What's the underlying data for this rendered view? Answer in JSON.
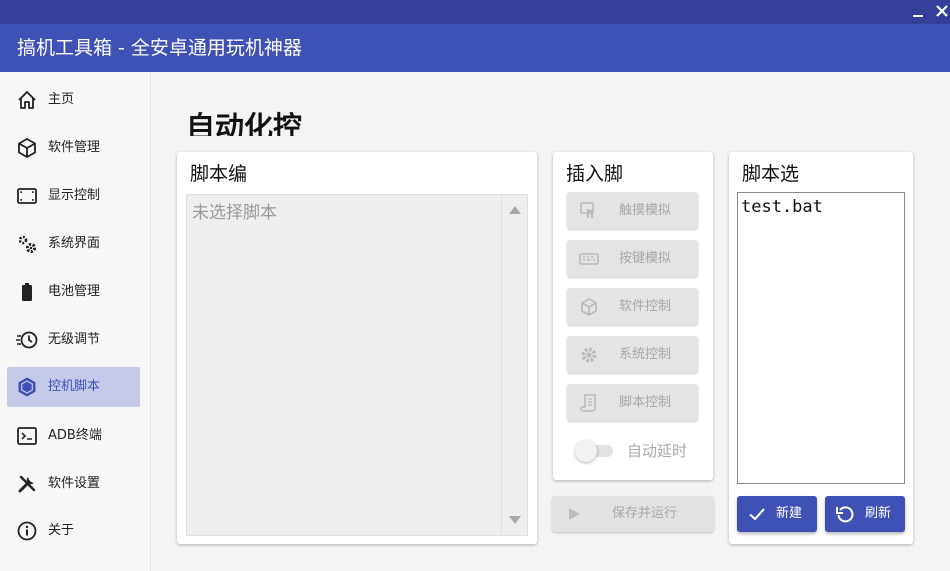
{
  "window": {
    "title": "搞机工具箱 - 全安卓通用玩机神器",
    "accent_color": "#3f51b5",
    "titlebar_strip_color": "#32409a",
    "controls": [
      "minimize-icon",
      "close-icon"
    ]
  },
  "sidebar": {
    "active_index": 6,
    "items": [
      {
        "label": "主页",
        "icon": "home-icon"
      },
      {
        "label": "软件管理",
        "icon": "package-icon"
      },
      {
        "label": "显示控制",
        "icon": "screen-icon"
      },
      {
        "label": "系统界面",
        "icon": "gears-icon"
      },
      {
        "label": "电池管理",
        "icon": "battery-icon"
      },
      {
        "label": "无级调节",
        "icon": "clock-speed-icon"
      },
      {
        "label": "控机脚本",
        "icon": "hexagon-icon"
      },
      {
        "label": "ADB终端",
        "icon": "terminal-icon"
      },
      {
        "label": "软件设置",
        "icon": "tools-icon"
      },
      {
        "label": "关于",
        "icon": "info-icon"
      }
    ]
  },
  "main": {
    "page_title": "自动化控",
    "editor": {
      "title": "脚本编",
      "placeholder_text": "未选择脚本"
    },
    "insert": {
      "title": "插入脚",
      "buttons": [
        {
          "label": "触摸模拟",
          "icon": "touch-icon"
        },
        {
          "label": "按键模拟",
          "icon": "keyboard-icon"
        },
        {
          "label": "软件控制",
          "icon": "package-icon"
        },
        {
          "label": "系统控制",
          "icon": "gear-icon"
        },
        {
          "label": "脚本控制",
          "icon": "script-icon"
        }
      ],
      "auto_delay_label": "自动延时",
      "auto_delay_enabled": false
    },
    "save_run_label": "保存并运行",
    "selector": {
      "title": "脚本选",
      "scripts": [
        "test.bat"
      ],
      "new_label": "新建",
      "refresh_label": "刷新"
    }
  }
}
